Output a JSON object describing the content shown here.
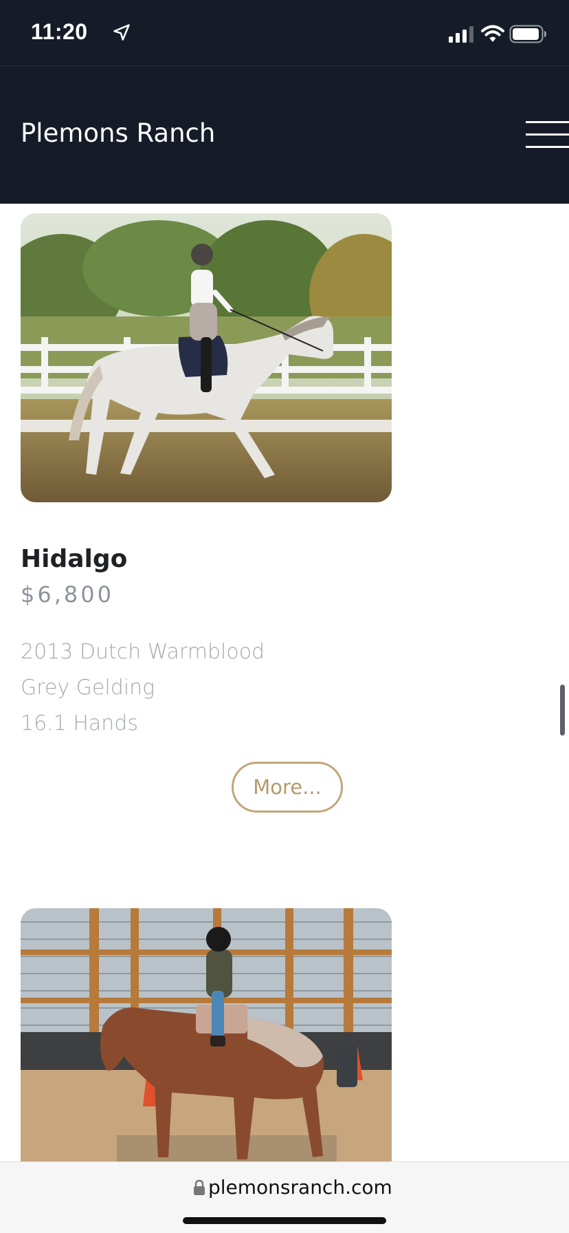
{
  "status_bar": {
    "time": "11:20"
  },
  "header": {
    "title": "Plemons Ranch"
  },
  "listing": {
    "name": "Hidalgo",
    "price": "$6,800",
    "details": [
      "2013 Dutch Warmblood",
      "Grey Gelding",
      "16.1 Hands"
    ],
    "more_label": "More..."
  },
  "browser": {
    "url": "plemonsranch.com"
  },
  "colors": {
    "header_bg": "#161c27",
    "accent": "#c0a67a"
  },
  "icons": {
    "location": "location-arrow-icon",
    "signal": "cellular-signal-icon",
    "wifi": "wifi-icon",
    "battery": "battery-icon",
    "menu": "hamburger-menu-icon",
    "lock": "lock-icon"
  }
}
